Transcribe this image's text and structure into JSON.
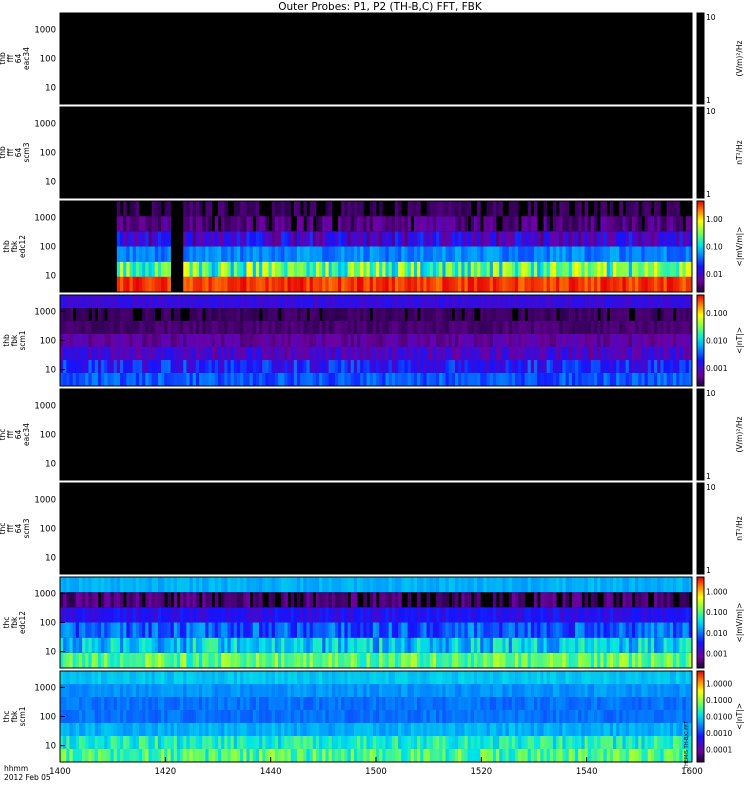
{
  "chart_data": {
    "type": "heatmap",
    "title": "Outer Probes: P1, P2 (TH-B,C) FFT, FBK",
    "x_ticks": [
      "1400",
      "1420",
      "1440",
      "1500",
      "1520",
      "1540",
      "1600"
    ],
    "x_label_lines": [
      "hhmm",
      "2012 Feb 05"
    ],
    "y_scale": "log",
    "y_ticks": [
      "10",
      "100",
      "1000"
    ],
    "panels": [
      {
        "id": "thb-fff-eac34",
        "label_lines": [
          "thb",
          "fff",
          "64",
          "eac34"
        ],
        "colorbar_title": "(V/m)²/Hz",
        "colorbar_ticks": [
          "1",
          "10"
        ],
        "colorbar_type": "black",
        "frequency_bins": 0
      },
      {
        "id": "thb-fff-scm3",
        "label_lines": [
          "thb",
          "fff",
          "64",
          "scm3"
        ],
        "colorbar_title": "nT²/Hz",
        "colorbar_ticks": [
          "1",
          "10"
        ],
        "colorbar_type": "black",
        "frequency_bins": 0
      },
      {
        "id": "thb-fbk-edc12",
        "label_lines": [
          "thb",
          "fbk",
          "edc12"
        ],
        "colorbar_title": "<|mV/m|>",
        "colorbar_ticks": [
          "0.01",
          "0.10",
          "1.00"
        ],
        "colorbar_type": "rainbow",
        "frequency_bins": 6,
        "data_start_fraction": 0.09,
        "band_levels": [
          {
            "level": 0.95,
            "variance": 0.05
          },
          {
            "level": 0.62,
            "variance": 0.18
          },
          {
            "level": 0.4,
            "variance": 0.06
          },
          {
            "level": 0.2,
            "variance": 0.12
          },
          {
            "level": 0.08,
            "variance": 0.08
          },
          {
            "level": 0.03,
            "variance": 0.05
          }
        ],
        "gaps": [
          {
            "from": 0.175,
            "to": 0.19
          }
        ]
      },
      {
        "id": "thb-fbk-scm1",
        "label_lines": [
          "thb",
          "fbk",
          "scm1"
        ],
        "colorbar_title": "<|nT|>",
        "colorbar_ticks": [
          "0.001",
          "0.010",
          "0.100"
        ],
        "colorbar_type": "rainbow",
        "frequency_bins": 7,
        "data_start_fraction": 0,
        "band_levels": [
          {
            "level": 0.35,
            "variance": 0.06
          },
          {
            "level": 0.28,
            "variance": 0.1
          },
          {
            "level": 0.18,
            "variance": 0.08
          },
          {
            "level": 0.12,
            "variance": 0.05
          },
          {
            "level": 0.06,
            "variance": 0.03
          },
          {
            "level": 0.04,
            "variance": 0.03
          },
          {
            "level": 0.22,
            "variance": 0.03
          }
        ],
        "gaps": []
      },
      {
        "id": "thc-fff-eac34",
        "label_lines": [
          "thc",
          "fff",
          "64",
          "eac34"
        ],
        "colorbar_title": "(V/m)²/Hz",
        "colorbar_ticks": [
          "1",
          "10"
        ],
        "colorbar_type": "black",
        "frequency_bins": 0
      },
      {
        "id": "thc-fff-scm3",
        "label_lines": [
          "thc",
          "fff",
          "64",
          "scm3"
        ],
        "colorbar_title": "nT²/Hz",
        "colorbar_ticks": [
          "1",
          "10"
        ],
        "colorbar_type": "black",
        "frequency_bins": 0
      },
      {
        "id": "thc-fbk-edc12",
        "label_lines": [
          "thc",
          "fbk",
          "edc12"
        ],
        "colorbar_title": "<|mV/m|>",
        "colorbar_ticks": [
          "0.001",
          "0.010",
          "0.100",
          "1.000"
        ],
        "colorbar_type": "rainbow",
        "frequency_bins": 6,
        "data_start_fraction": 0,
        "band_levels": [
          {
            "level": 0.62,
            "variance": 0.1
          },
          {
            "level": 0.48,
            "variance": 0.12
          },
          {
            "level": 0.35,
            "variance": 0.1
          },
          {
            "level": 0.25,
            "variance": 0.05
          },
          {
            "level": 0.05,
            "variance": 0.08
          },
          {
            "level": 0.45,
            "variance": 0.03
          }
        ],
        "gaps": []
      },
      {
        "id": "thc-fbk-scm1",
        "label_lines": [
          "thc",
          "fbk",
          "scm1"
        ],
        "colorbar_title": "<|nT|>",
        "colorbar_ticks": [
          "0.0001",
          "0.0010",
          "0.0100",
          "0.1000",
          "1.0000"
        ],
        "colorbar_type": "rainbow",
        "frequency_bins": 7,
        "data_start_fraction": 0,
        "band_levels": [
          {
            "level": 0.6,
            "variance": 0.1
          },
          {
            "level": 0.55,
            "variance": 0.08
          },
          {
            "level": 0.45,
            "variance": 0.04
          },
          {
            "level": 0.38,
            "variance": 0.03
          },
          {
            "level": 0.38,
            "variance": 0.03
          },
          {
            "level": 0.42,
            "variance": 0.03
          },
          {
            "level": 0.48,
            "variance": 0.03
          }
        ],
        "gaps": []
      }
    ],
    "side_annotation": "THEMIS TH-B/C FFT",
    "grid": false,
    "legend": "colorbars-right"
  }
}
